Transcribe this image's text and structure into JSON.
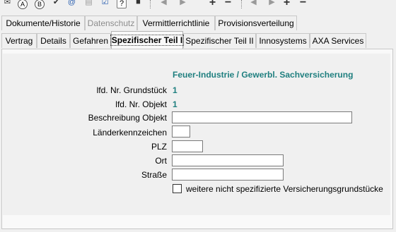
{
  "toolbar": {
    "icons": [
      "mail-icon",
      "address-book-icon",
      "address-book-b-icon",
      "check-icon",
      "at-icon",
      "print-icon",
      "checklist-icon",
      "help-icon",
      "info-icon",
      "nav-left-icon",
      "nav-right-icon",
      "add-icon",
      "remove-icon",
      "nav-left-2-icon",
      "nav-right-2-icon",
      "add-2-icon",
      "remove-2-icon"
    ]
  },
  "tabs_row1": [
    {
      "label": "Dokumente/Historie",
      "disabled": false
    },
    {
      "label": "Datenschutz",
      "disabled": true
    },
    {
      "label": "Vermittlerrichtlinie",
      "disabled": false
    },
    {
      "label": "Provisionsverteilung",
      "disabled": false
    }
  ],
  "tabs_row2": [
    {
      "label": "Vertrag"
    },
    {
      "label": "Details"
    },
    {
      "label": "Gefahren"
    },
    {
      "label": "Spezifischer Teil I",
      "active": true
    },
    {
      "label": "Spezifischer Teil II"
    },
    {
      "label": "Innosystems"
    },
    {
      "label": "AXA Services"
    }
  ],
  "form": {
    "section_title": "Feuer-Industrie / Gewerbl. Sachversicherung",
    "lfd_grundstueck_label": "lfd. Nr. Grundstück",
    "lfd_grundstueck_value": "1",
    "lfd_objekt_label": "lfd. Nr. Objekt",
    "lfd_objekt_value": "1",
    "beschreibung_label": "Beschreibung Objekt",
    "beschreibung_value": "",
    "laenderkennzeichen_label": "Länderkennzeichen",
    "laenderkennzeichen_value": "",
    "plz_label": "PLZ",
    "plz_value": "",
    "ort_label": "Ort",
    "ort_value": "",
    "strasse_label": "Straße",
    "strasse_value": "",
    "weitere_checkbox_label": "weitere nicht spezifizierte Versicherungsgrundstücke",
    "weitere_checked": false
  }
}
